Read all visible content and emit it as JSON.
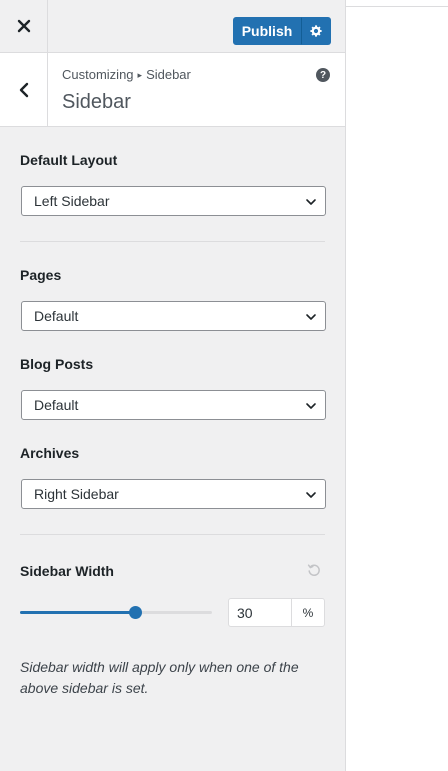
{
  "header": {
    "close_icon": "close-icon",
    "publish_label": "Publish",
    "publish_settings_icon": "gear-icon"
  },
  "section": {
    "breadcrumb_parent": "Customizing",
    "breadcrumb_current": "Sidebar",
    "title": "Sidebar",
    "back_icon": "chevron-left-icon",
    "help_icon": "help-icon",
    "help_glyph": "?"
  },
  "controls": {
    "default_layout": {
      "label": "Default Layout",
      "value": "Left Sidebar"
    },
    "pages": {
      "label": "Pages",
      "value": "Default"
    },
    "blog_posts": {
      "label": "Blog Posts",
      "value": "Default"
    },
    "archives": {
      "label": "Archives",
      "value": "Right Sidebar"
    },
    "sidebar_width": {
      "label": "Sidebar Width",
      "value": "30",
      "unit": "%",
      "slider_fraction": 0.6,
      "reset_icon": "reset-icon",
      "description": "Sidebar width will apply only when one of the above sidebar is set."
    }
  },
  "colors": {
    "accent": "#2271b1",
    "panel_bg": "#f0f0f1",
    "border": "#dcdcde"
  }
}
